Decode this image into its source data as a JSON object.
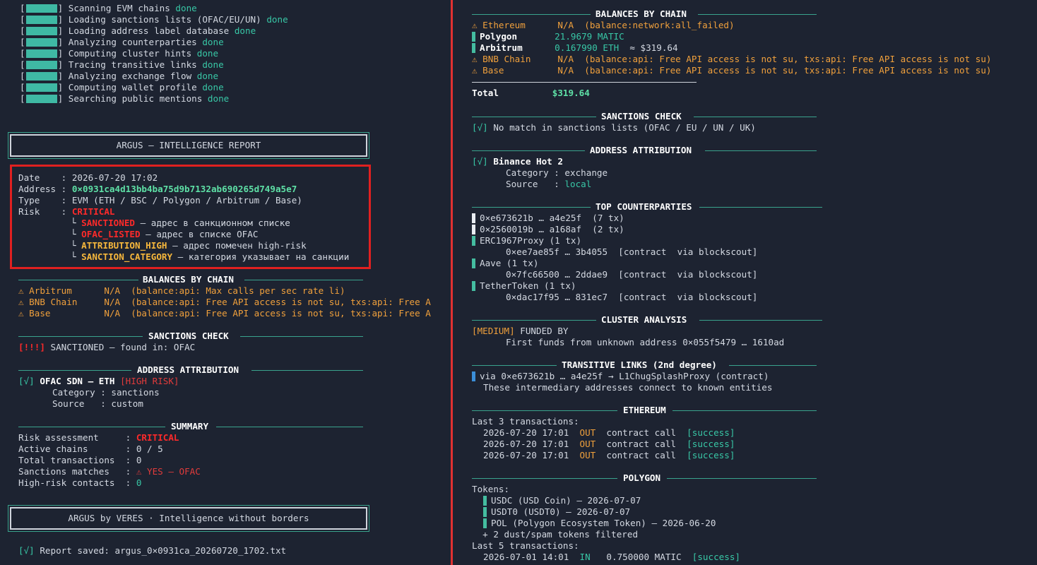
{
  "progress": [
    {
      "label": "Scanning EVM chains",
      "status": "done"
    },
    {
      "label": "Loading sanctions lists (OFAC/EU/UN)",
      "status": "done"
    },
    {
      "label": "Loading address label database",
      "status": "done"
    },
    {
      "label": "Analyzing counterparties",
      "status": "done"
    },
    {
      "label": "Computing cluster hints",
      "status": "done"
    },
    {
      "label": "Tracing transitive links",
      "status": "done"
    },
    {
      "label": "Analyzing exchange flow",
      "status": "done"
    },
    {
      "label": "Computing wallet profile",
      "status": "done"
    },
    {
      "label": "Searching public mentions",
      "status": "done"
    }
  ],
  "report_title": "ARGUS — INTELLIGENCE REPORT",
  "info": {
    "date_key": "Date",
    "date": "2026-07-20 17:02",
    "address_key": "Address",
    "address": "0×0931ca4d13bb4ba75d9b7132ab690265d749a5e7",
    "type_key": "Type",
    "type": "EVM (ETH / BSC / Polygon / Arbitrum / Base)",
    "risk_key": "Risk",
    "risk": "CRITICAL",
    "flags": [
      {
        "code": "SANCTIONED",
        "desc": "— адрес в санкционном списке"
      },
      {
        "code": "OFAC_LISTED",
        "desc": "— адрес в списке OFAC"
      },
      {
        "code": "ATTRIBUTION_HIGH",
        "desc": "— адрес помечен high-risk"
      },
      {
        "code": "SANCTION_CATEGORY",
        "desc": "— категория указывает на санкции"
      }
    ]
  },
  "left_balances": {
    "title": "BALANCES BY CHAIN",
    "rows": [
      {
        "chain": "Arbitrum",
        "value": "N/A",
        "note": "(balance:api: Max calls per sec rate li)"
      },
      {
        "chain": "BNB Chain",
        "value": "N/A",
        "note": "(balance:api: Free API access is not su, txs:api: Free A"
      },
      {
        "chain": "Base",
        "value": "N/A",
        "note": "(balance:api: Free API access is not su, txs:api: Free A"
      }
    ]
  },
  "left_sanctions": {
    "title": "SANCTIONS CHECK",
    "tag": "[!!!]",
    "text": "SANCTIONED — found in: OFAC"
  },
  "left_attribution": {
    "title": "ADDRESS ATTRIBUTION",
    "check": "[√]",
    "name": "OFAC SDN — ETH",
    "badge": "[HIGH RISK]",
    "category_key": "Category :",
    "category": "sanctions",
    "source_key": "Source   :",
    "source": "custom"
  },
  "summary": {
    "title": "SUMMARY",
    "rows": [
      {
        "key": "Risk assessment     :",
        "value": "CRITICAL"
      },
      {
        "key": "Active chains       :",
        "value": "0 / 5"
      },
      {
        "key": "Total transactions  :",
        "value": "0"
      },
      {
        "key": "Sanctions matches   :",
        "value": "⚠ YES — OFAC"
      },
      {
        "key": "High-risk contacts  :",
        "value": "0"
      }
    ]
  },
  "footer_title": "ARGUS by VERES · Intelligence without borders",
  "saved": {
    "check": "[√]",
    "text": "Report saved: argus_0×0931ca_20260720_1702.txt"
  },
  "right_balances": {
    "title": "BALANCES BY CHAIN",
    "rows": [
      {
        "chain": "Ethereum",
        "value": "N/A",
        "note": "(balance:network:all_failed)"
      },
      {
        "chain": "Polygon",
        "value": "21.9679 MATIC",
        "note": ""
      },
      {
        "chain": "Arbitrum",
        "value": "0.167990 ETH",
        "note": "≈ $319.64"
      },
      {
        "chain": "BNB Chain",
        "value": "N/A",
        "note": "(balance:api: Free API access is not su, txs:api: Free API access is not su)"
      },
      {
        "chain": "Base",
        "value": "N/A",
        "note": "(balance:api: Free API access is not su, txs:api: Free API access is not su)"
      }
    ],
    "total_label": "Total",
    "total": "$319.64"
  },
  "right_sanctions": {
    "title": "SANCTIONS CHECK",
    "check": "[√]",
    "text": "No match in sanctions lists (OFAC / EU / UN / UK)"
  },
  "right_attribution": {
    "title": "ADDRESS ATTRIBUTION",
    "check": "[√]",
    "name": "Binance Hot 2",
    "category_key": "Category :",
    "category": "exchange",
    "source_key": "Source   :",
    "source": "local"
  },
  "counterparties": {
    "title": "TOP COUNTERPARTIES",
    "rows": [
      {
        "addr": "0×e673621b … a4e25f",
        "count": "(7 tx)"
      },
      {
        "addr": "0×2560019b … a168af",
        "count": "(2 tx)"
      }
    ],
    "contracts": [
      {
        "name": "ERC1967Proxy (1 tx)",
        "addr": "0×ee7ae85f … 3b4055",
        "meta": "[contract  via blockscout]"
      },
      {
        "name": "Aave (1 tx)",
        "addr": "0×7fc66500 … 2ddae9",
        "meta": "[contract  via blockscout]"
      },
      {
        "name": "TetherToken (1 tx)",
        "addr": "0×dac17f95 … 831ec7",
        "meta": "[contract  via blockscout]"
      }
    ]
  },
  "cluster": {
    "title": "CLUSTER ANALYSIS",
    "level": "[MEDIUM]",
    "label": "FUNDED BY",
    "text": "First funds from unknown address 0×055f5479 … 1610ad"
  },
  "transitive": {
    "title": "TRANSITIVE LINKS (2nd degree)",
    "link": "via 0×e673621b … a4e25f → L1ChugSplashProxy (contract)",
    "note": "These intermediary addresses connect to known entities"
  },
  "ethereum": {
    "title": "ETHEREUM",
    "heading": "Last 3 transactions:",
    "txs": [
      {
        "time": "2026-07-20 17:01",
        "dir": "OUT",
        "desc": "contract call",
        "status": "[success]"
      },
      {
        "time": "2026-07-20 17:01",
        "dir": "OUT",
        "desc": "contract call",
        "status": "[success]"
      },
      {
        "time": "2026-07-20 17:01",
        "dir": "OUT",
        "desc": "contract call",
        "status": "[success]"
      }
    ]
  },
  "polygon": {
    "title": "POLYGON",
    "tokens_heading": "Tokens:",
    "tokens": [
      "USDC (USD Coin) — 2026-07-07",
      "USDT0 (USDT0) — 2026-07-07",
      "POL (Polygon Ecosystem Token) — 2026-06-20"
    ],
    "filtered": "+ 2 dust/spam tokens filtered",
    "tx_heading": "Last 5 transactions:",
    "tx": {
      "time": "2026-07-01 14:01",
      "dir": "IN",
      "desc": "0.750000 MATIC",
      "status": "[success]"
    }
  }
}
